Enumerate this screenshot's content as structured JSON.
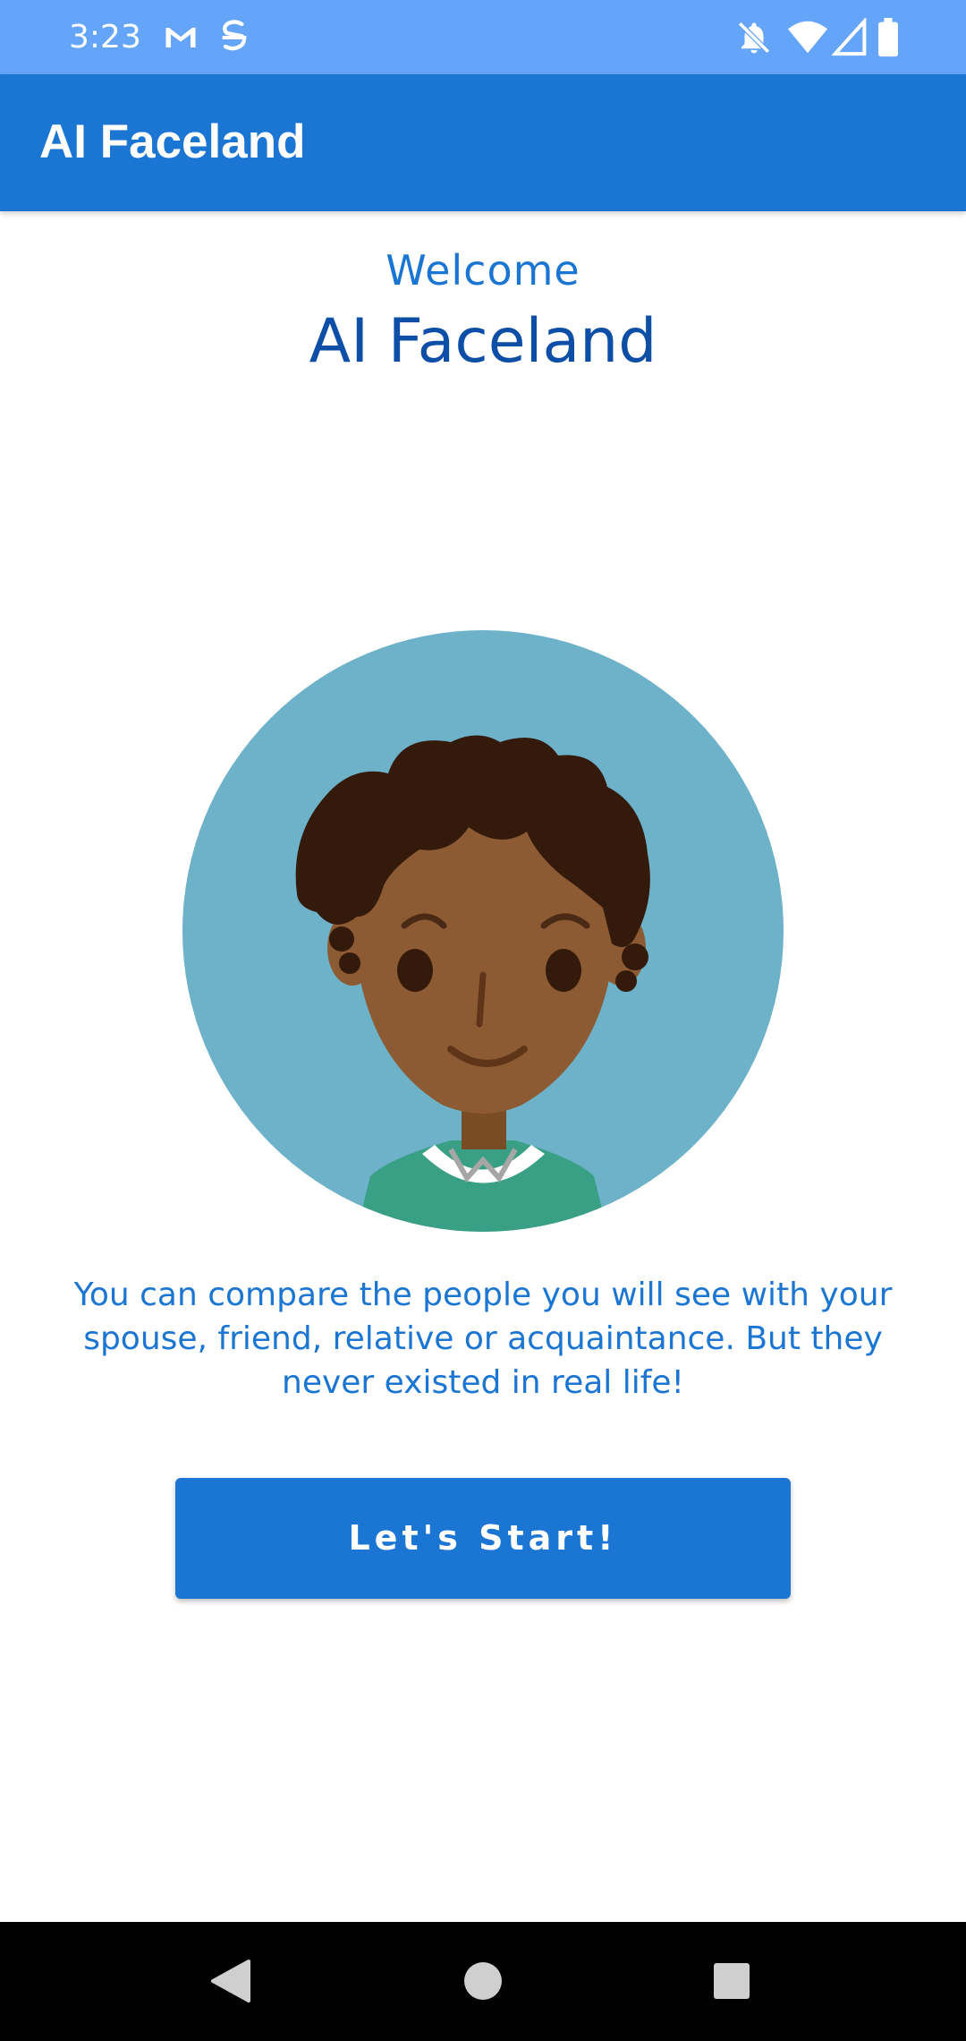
{
  "status_bar": {
    "time": "3:23",
    "icons_left": [
      "gmail-icon",
      "sync-icon"
    ],
    "icons_right": [
      "notifications-off-icon",
      "wifi-icon",
      "signal-icon",
      "battery-icon"
    ],
    "color": "#64a4f9"
  },
  "app_bar": {
    "title": "AI Faceland",
    "color": "#1b76d3"
  },
  "main": {
    "welcome": "Welcome",
    "headline": "AI Faceland",
    "avatar_icon": "avatar-illustration",
    "description": "You can compare the people you will see with your spouse, friend, relative or acquaintance. But they never existed in real life!",
    "start_button_label": "Let's Start!"
  },
  "nav_bar": {
    "icons": [
      "back-icon",
      "home-icon",
      "recents-icon"
    ]
  }
}
